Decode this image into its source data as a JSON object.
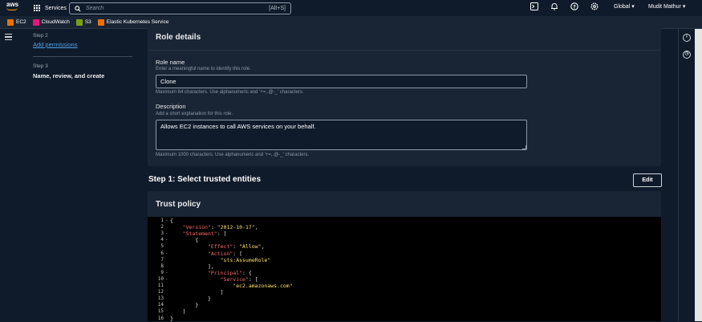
{
  "topbar": {
    "logo_text": "aws",
    "services_label": "Services",
    "search_placeholder": "Search",
    "search_shortcut": "[Alt+S]",
    "region": "Global",
    "user": "Mudit Mathur"
  },
  "favorites": [
    {
      "label": "EC2",
      "color": "#ed7100"
    },
    {
      "label": "CloudWatch",
      "color": "#e7157b"
    },
    {
      "label": "S3",
      "color": "#7aa116"
    },
    {
      "label": "Elastic Kubernetes Service",
      "color": "#ed7100"
    }
  ],
  "steps": {
    "step2_label": "Step 2",
    "step2_link": "Add permissions",
    "step3_label": "Step 3",
    "step3_title": "Name, review, and create"
  },
  "role_details": {
    "header": "Role details",
    "name_label": "Role name",
    "name_hint": "Enter a meaningful name to identify this role.",
    "name_value": "Clone",
    "name_constraint": "Maximum 64 characters. Use alphanumeric and '+=,.@-_' characters.",
    "desc_label": "Description",
    "desc_hint": "Add a short explanation for this role.",
    "desc_value": "Allows EC2 instances to call AWS services on your behalf.",
    "desc_constraint": "Maximum 1000 characters. Use alphanumeric and '+=,.@-_' characters."
  },
  "step1": {
    "title": "Step 1: Select trusted entities",
    "edit_label": "Edit"
  },
  "trust_policy": {
    "header": "Trust policy",
    "line_numbers": [
      "1",
      "2",
      "3",
      "4",
      "5",
      "6",
      "7",
      "8",
      "9",
      "10",
      "11",
      "12",
      "13",
      "14",
      "15",
      "16"
    ],
    "lines": [
      {
        "parts": [
          {
            "t": "{",
            "c": "p"
          }
        ]
      },
      {
        "parts": [
          {
            "t": "    ",
            "c": "p"
          },
          {
            "t": "\"Version\"",
            "c": "k"
          },
          {
            "t": ": ",
            "c": "p"
          },
          {
            "t": "\"2012-10-17\"",
            "c": "s"
          },
          {
            "t": ",",
            "c": "p"
          }
        ]
      },
      {
        "parts": [
          {
            "t": "    ",
            "c": "p"
          },
          {
            "t": "\"Statement\"",
            "c": "k"
          },
          {
            "t": ": [",
            "c": "p"
          }
        ]
      },
      {
        "parts": [
          {
            "t": "        {",
            "c": "p"
          }
        ]
      },
      {
        "parts": [
          {
            "t": "            ",
            "c": "p"
          },
          {
            "t": "\"Effect\"",
            "c": "k"
          },
          {
            "t": ": ",
            "c": "p"
          },
          {
            "t": "\"Allow\"",
            "c": "s"
          },
          {
            "t": ",",
            "c": "p"
          }
        ]
      },
      {
        "parts": [
          {
            "t": "            ",
            "c": "p"
          },
          {
            "t": "\"Action\"",
            "c": "k"
          },
          {
            "t": ": [",
            "c": "p"
          }
        ]
      },
      {
        "parts": [
          {
            "t": "                ",
            "c": "p"
          },
          {
            "t": "\"sts:AssumeRole\"",
            "c": "s"
          }
        ]
      },
      {
        "parts": [
          {
            "t": "            ],",
            "c": "p"
          }
        ]
      },
      {
        "parts": [
          {
            "t": "            ",
            "c": "p"
          },
          {
            "t": "\"Principal\"",
            "c": "k"
          },
          {
            "t": ": {",
            "c": "p"
          }
        ]
      },
      {
        "parts": [
          {
            "t": "                ",
            "c": "p"
          },
          {
            "t": "\"Service\"",
            "c": "k"
          },
          {
            "t": ": [",
            "c": "p"
          }
        ]
      },
      {
        "parts": [
          {
            "t": "                    ",
            "c": "p"
          },
          {
            "t": "\"ec2.amazonaws.com\"",
            "c": "s"
          }
        ]
      },
      {
        "parts": [
          {
            "t": "                ]",
            "c": "p"
          }
        ]
      },
      {
        "parts": [
          {
            "t": "            }",
            "c": "p"
          }
        ]
      },
      {
        "parts": [
          {
            "t": "        }",
            "c": "p"
          }
        ]
      },
      {
        "parts": [
          {
            "t": "    ]",
            "c": "p"
          }
        ]
      },
      {
        "parts": [
          {
            "t": "}",
            "c": "p"
          }
        ]
      }
    ],
    "fold_marks": [
      "-",
      "",
      "-",
      "-",
      "",
      "-",
      "",
      "",
      "-",
      "-",
      "",
      "",
      "",
      "",
      "",
      ""
    ]
  }
}
